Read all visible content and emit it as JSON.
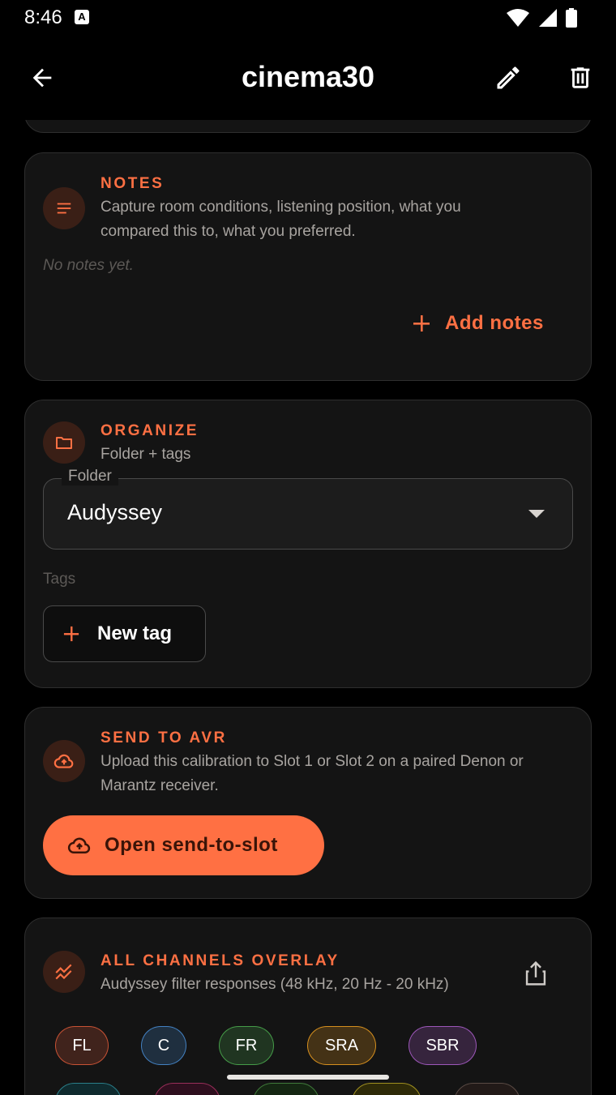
{
  "status_bar": {
    "time": "8:46",
    "indicator": "A"
  },
  "app_bar": {
    "title": "cinema30"
  },
  "notes": {
    "title": "NOTES",
    "subtitle_line1": "Capture room conditions, listening position, what you",
    "subtitle_line2": "compared this to, what you preferred.",
    "empty_text": "No notes yet.",
    "add_label": "Add notes"
  },
  "organize": {
    "title": "ORGANIZE",
    "subtitle": "Folder + tags",
    "folder_label": "Folder",
    "folder_value": "Audyssey",
    "tags_label": "Tags",
    "new_tag_label": "New tag"
  },
  "send": {
    "title": "SEND TO AVR",
    "subtitle_line1": "Upload this calibration to Slot 1 or Slot 2 on a paired Denon or",
    "subtitle_line2": "Marantz receiver.",
    "button_label": "Open send-to-slot"
  },
  "overlay": {
    "title": "ALL CHANNELS OVERLAY",
    "subtitle": "Audyssey filter responses (48 kHz, 20 Hz - 20 kHz)",
    "channels": [
      {
        "label": "FL",
        "color": "#e05a3a"
      },
      {
        "label": "C",
        "color": "#4a90d9"
      },
      {
        "label": "FR",
        "color": "#4caf50"
      },
      {
        "label": "SRA",
        "color": "#f0a020"
      },
      {
        "label": "SBR",
        "color": "#b060d0"
      }
    ]
  },
  "colors": {
    "accent": "#ff7043",
    "card": "#141414",
    "background": "#000000"
  }
}
